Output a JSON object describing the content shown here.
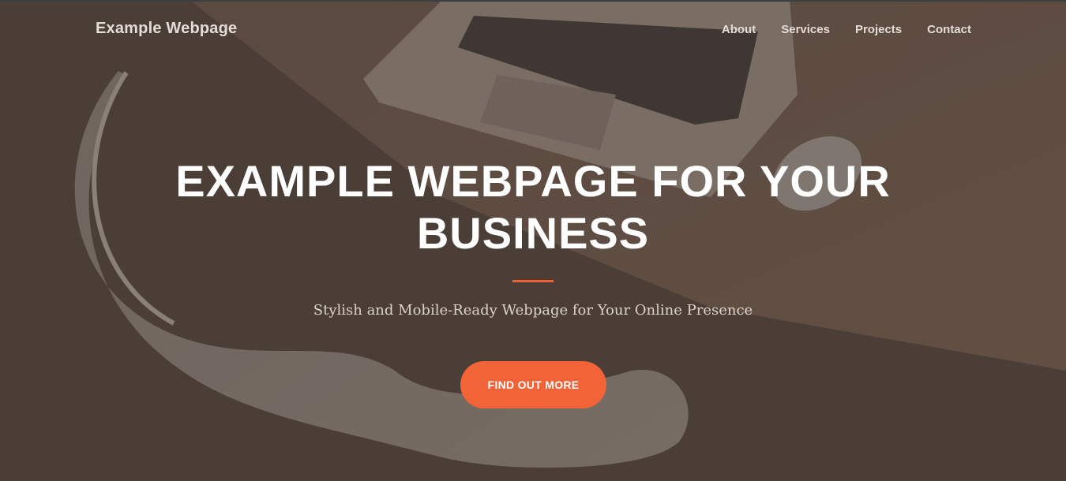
{
  "navbar": {
    "brand": "Example Webpage",
    "links": [
      "About",
      "Services",
      "Projects",
      "Contact"
    ]
  },
  "hero": {
    "headline_line1": "EXAMPLE WEBPAGE FOR YOUR",
    "headline_line2": "BUSINESS",
    "subtitle": "Stylish and Mobile-Ready Webpage for Your Online Presence",
    "cta_label": "FIND OUT MORE"
  },
  "colors": {
    "accent": "#f26338",
    "overlay": "#4b3e36",
    "text_light": "#ffffff"
  }
}
